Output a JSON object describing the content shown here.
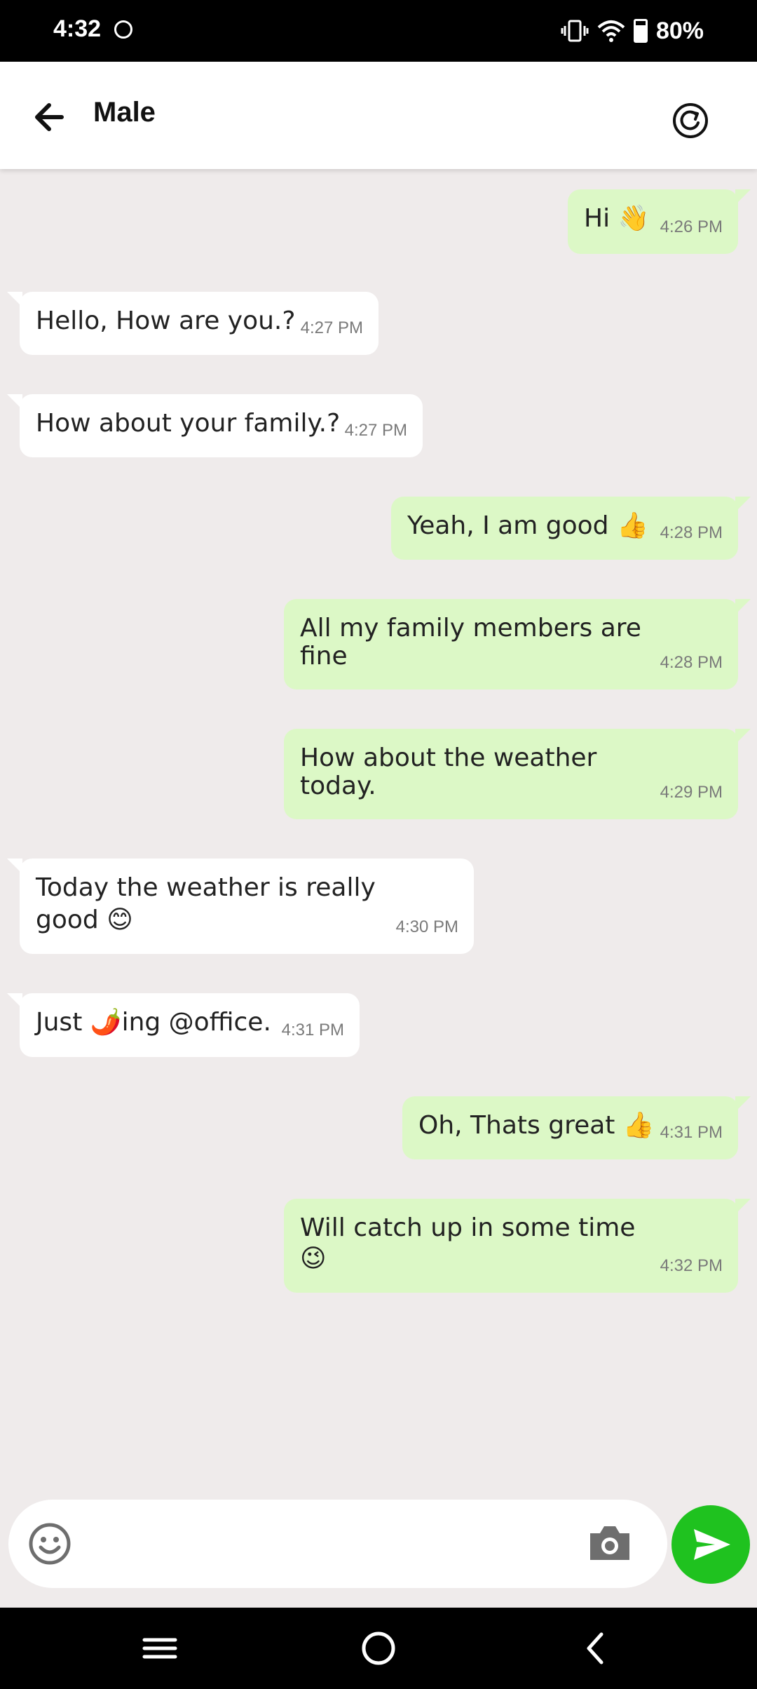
{
  "status_bar": {
    "time": "4:32",
    "battery": "80%"
  },
  "header": {
    "title": "Male"
  },
  "messages": [
    {
      "dir": "out",
      "text": "Hi 👋",
      "time": "4:26 PM"
    },
    {
      "dir": "in",
      "text": "Hello, How are you.?",
      "time": "4:27 PM"
    },
    {
      "dir": "in",
      "text": "How about your family.?",
      "time": "4:27 PM"
    },
    {
      "dir": "out",
      "text": "Yeah, I am good 👍",
      "time": "4:28 PM"
    },
    {
      "dir": "out",
      "text": "All my family members are",
      "text2": "fine",
      "time": "4:28 PM"
    },
    {
      "dir": "out",
      "text": "How about the weather",
      "text2": "today.",
      "time": "4:29 PM"
    },
    {
      "dir": "in",
      "text": "Today the weather is really",
      "text2": "good 😊",
      "time": "4:30 PM"
    },
    {
      "dir": "in",
      "text": "Just 🌶️ing @office.",
      "time": "4:31 PM"
    },
    {
      "dir": "out",
      "text": "Oh, Thats great 👍",
      "time": "4:31 PM"
    },
    {
      "dir": "out",
      "text": "Will catch up in some time",
      "text2": "😉",
      "time": "4:32 PM"
    }
  ],
  "composer": {
    "placeholder": ""
  },
  "colors": {
    "outgoing": "#dcf8c6",
    "incoming": "#ffffff",
    "send": "#1fc21f",
    "background": "#efebeb"
  },
  "icons": [
    "back-arrow-icon",
    "refresh-icon",
    "smiley-icon",
    "camera-icon",
    "send-icon",
    "menu-icon",
    "home-icon",
    "back-nav-icon"
  ]
}
